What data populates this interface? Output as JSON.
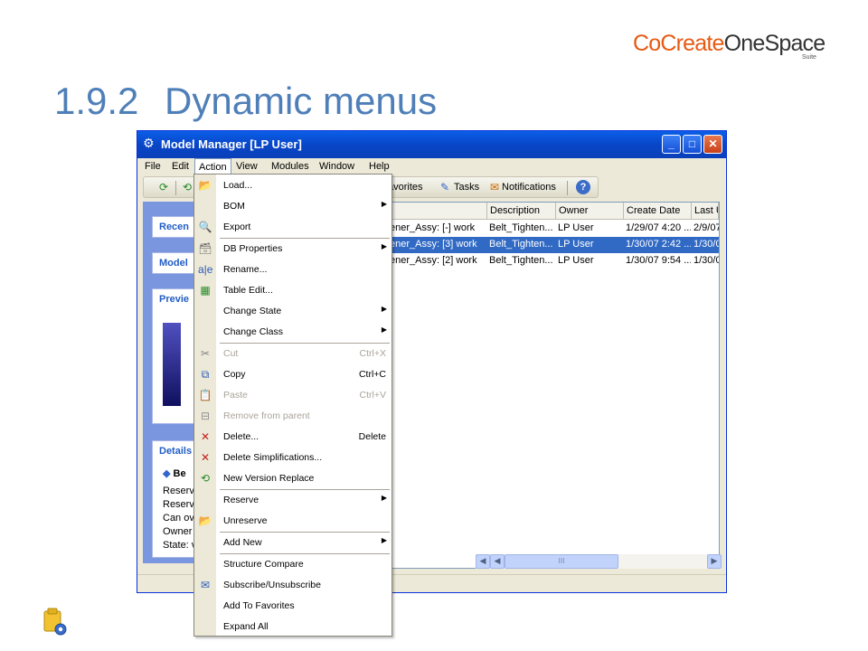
{
  "slide": {
    "logo_part1": "CoCreate",
    "logo_part2": "OneSpace",
    "logo_sub": "Suite",
    "section_number": "1.9.2",
    "section_title": "Dynamic menus"
  },
  "window": {
    "title": "Model Manager [LP User]",
    "minimize": "_",
    "maximize": "□",
    "close": "✕"
  },
  "menubar": [
    "File",
    "Edit",
    "Action",
    "View",
    "Modules",
    "Window",
    "Help"
  ],
  "toolbar": {
    "favorites": "avorites",
    "tasks": "Tasks",
    "notifications": "Notifications",
    "help": "?"
  },
  "left_panel": {
    "recent": "Recen",
    "model": "Model",
    "preview": "Previe",
    "details": "Details",
    "detail_title": "Be",
    "detail_lines": [
      "Reserv",
      "Reserv",
      "Can ov",
      "Owner",
      "State: v"
    ]
  },
  "table": {
    "headers": [
      "",
      "Description",
      "Owner",
      "Create Date",
      "Last U"
    ],
    "rows": [
      {
        "name": "ener_Assy: [-] work",
        "description": "Belt_Tighten...",
        "owner": "LP User",
        "create_date": "1/29/07 4:20 ...",
        "last": "2/9/07"
      },
      {
        "name": "ener_Assy: [3] work",
        "description": "Belt_Tighten...",
        "owner": "LP User",
        "create_date": "1/30/07 2:42 ...",
        "last": "1/30/0"
      },
      {
        "name": "ener_Assy: [2] work",
        "description": "Belt_Tighten...",
        "owner": "LP User",
        "create_date": "1/30/07 9:54 ...",
        "last": "1/30/0"
      }
    ],
    "scroll_thumb": "III"
  },
  "context_menu": {
    "items": [
      {
        "label": "Load...",
        "icon": "load-icon",
        "glyph": "📂"
      },
      {
        "label": "BOM",
        "submenu": true
      },
      {
        "label": "Export",
        "icon": "export-icon",
        "glyph": "🔍"
      },
      {
        "label": "DB Properties",
        "submenu": true,
        "icon": "db-properties-icon",
        "glyph": "🗃"
      },
      {
        "label": "Rename...",
        "icon": "rename-icon",
        "glyph": "a|e"
      },
      {
        "label": "Table Edit...",
        "icon": "table-edit-icon",
        "glyph": "▦"
      },
      {
        "label": "Change State",
        "submenu": true
      },
      {
        "label": "Change Class",
        "submenu": true
      },
      {
        "label": "Cut",
        "shortcut": "Ctrl+X",
        "disabled": true,
        "icon": "scissors-icon",
        "glyph": "✂"
      },
      {
        "label": "Copy",
        "shortcut": "Ctrl+C",
        "icon": "copy-icon",
        "glyph": "⧉"
      },
      {
        "label": "Paste",
        "shortcut": "Ctrl+V",
        "disabled": true,
        "icon": "paste-icon",
        "glyph": "📋"
      },
      {
        "label": "Remove from parent",
        "disabled": true,
        "icon": "remove-from-parent-icon",
        "glyph": "⊟"
      },
      {
        "label": "Delete...",
        "shortcut": "Delete",
        "icon": "delete-icon",
        "glyph": "✕"
      },
      {
        "label": "Delete Simplifications...",
        "icon": "delete-simplifications-icon",
        "glyph": "✕"
      },
      {
        "label": "New Version Replace",
        "icon": "new-version-icon",
        "glyph": "⟲"
      },
      {
        "label": "Reserve",
        "submenu": true
      },
      {
        "label": "Unreserve",
        "icon": "unreserve-icon",
        "glyph": "📂"
      },
      {
        "label": "Add New",
        "submenu": true
      },
      {
        "label": "Structure Compare"
      },
      {
        "label": "Subscribe/Unsubscribe",
        "icon": "subscribe-icon",
        "glyph": "✉"
      },
      {
        "label": "Add To Favorites"
      },
      {
        "label": "Expand All"
      }
    ]
  },
  "colors": {
    "title_blue": "#4f7fb8",
    "logo_orange": "#e65a14",
    "selection": "#316ac5",
    "titlebar": "#0a4fd8"
  }
}
